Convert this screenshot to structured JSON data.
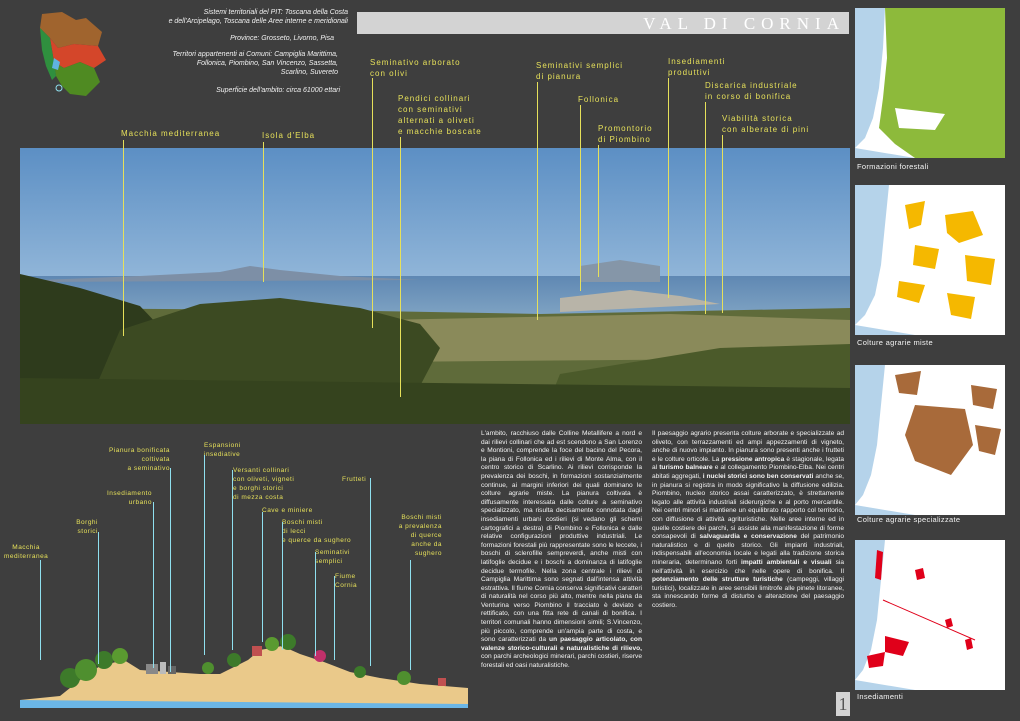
{
  "header": {
    "line1": "Sistemi territoriali del PIT: Toscana della Costa",
    "line2": "e dell'Arcipelago, Toscana delle Aree interne e meridionali",
    "title": "VAL DI CORNIA",
    "provinces": "Province: Grosseto, Livorno, Pisa",
    "municipalities_1": "Territori appartenenti ai Comuni: Campiglia Marittima,",
    "municipalities_2": "Follonica, Piombino, San Vincenzo, Sassetta,",
    "municipalities_3": "Scarlino, Suvereto",
    "area": "Superficie dell'ambito: circa 61000 ettari"
  },
  "panorama_labels": {
    "macchia": "Macchia mediterranea",
    "isola": "Isola d'Elba",
    "seminativo_arborato_1": "Seminativo arborato",
    "seminativo_arborato_2": "con olivi",
    "pendici_1": "Pendici collinari",
    "pendici_2": "con seminativi",
    "pendici_3": "alternati a oliveti",
    "pendici_4": "e macchie boscate",
    "seminativi_semplici_1": "Seminativi semplici",
    "seminativi_semplici_2": "di pianura",
    "follonica": "Follonica",
    "promontorio_1": "Promontorio",
    "promontorio_2": "di Piombino",
    "insediamenti_1": "Insediamenti",
    "insediamenti_2": "produttivi",
    "discarica_1": "Discarica industriale",
    "discarica_2": "in corso di bonifica",
    "viabilita_1": "Viabilità storica",
    "viabilita_2": "con alberate di pini"
  },
  "section_labels": {
    "espansioni_1": "Espansioni",
    "espansioni_2": "insediative",
    "pianura_1": "Pianura bonificata",
    "pianura_2": "coltivata",
    "pianura_3": "a seminativo",
    "versanti_1": "Versanti collinari",
    "versanti_2": "con oliveti, vigneti",
    "versanti_3": "e borghi storici",
    "versanti_4": "di mezza costa",
    "frutteti": "Frutteti",
    "insediamento_1": "Insediamento",
    "insediamento_2": "urbano",
    "cave": "Cave e miniere",
    "borghi_1": "Borghi",
    "borghi_2": "storici",
    "boschi_misti_1": "Boschi misti",
    "boschi_misti_2": "di lecci",
    "boschi_misti_3": "e querce da sughero",
    "boschi_prev_1": "Boschi misti",
    "boschi_prev_2": "a prevalenza",
    "boschi_prev_3": "di querce",
    "boschi_prev_4": "anche da",
    "boschi_prev_5": "sughero",
    "macchia_1": "Macchia",
    "macchia_2": "mediterranea",
    "seminativi_1": "Seminativi",
    "seminativi_2": "semplici",
    "fiume_1": "Fiume",
    "fiume_2": "Cornia"
  },
  "text_col1": "L'ambito, racchiuso dalle Colline Metallifere a nord e dai rilievi collinari che ad est scendono a San Lorenzo e Montioni, comprende la foce del bacino del Pecora, la piana di Follonica ed i rilievi di Monte Alma, con il centro storico di Scarlino. Ai rilievi corrisponde la prevalenza dei boschi, in formazioni sostanzialmente continue, ai margini inferiori dei quali dominano le colture agrarie miste. La pianura coltivata è diffusamente interessata dalle colture a seminativo specializzato, ma risulta decisamente connotata dagli insediamenti urbani costieri (si vedano gli schemi cartografici a destra) di Piombino e Follonica e dalle relative configurazioni produttive industriali. Le formazioni forestali più rappresentate sono le leccete, i boschi di sclerofille sempreverdi, anche misti con latifoglie decidue e i boschi a dominanza di latifoglie decidue termofile. Nella zona centrale i rilievi di Campiglia Marittima sono segnati dall'intensa attività estrattiva. Il fiume Cornia conserva significativi caratteri di naturalità nel corso più alto, mentre nella piana da Venturina verso Piombino il tracciato è deviato e rettificato, con una fitta rete di canali di bonifica. I territori comunali hanno dimensioni simili; S.Vincenzo, più piccolo, comprende un'ampia parte di costa, e sono caratterizzati da",
  "text_col1_bold": "un paesaggio articolato, con valenze storico-culturali e naturalistiche di rilievo,",
  "text_col1_end": " con parchi archeologici minerari, parchi costieri, riserve forestali ed oasi naturalistiche.",
  "text_col2_a": "Il paesaggio agrario presenta colture arborate e specializzate ad oliveto, con terrazzamenti ed ampi appezzamenti di vigneto, anche di nuovo impianto. In pianura sono presenti anche i frutteti e le colture orticole. La ",
  "text_col2_b": "pressione antropica",
  "text_col2_c": " è stagionale, legata al ",
  "text_col2_d": "turismo balneare",
  "text_col2_e": " e al collegamento Piombino-Elba. Nei centri abitati aggregati, ",
  "text_col2_f": "i nuclei storici sono ben conservati",
  "text_col2_g": " anche se, in pianura si registra in modo significativo la diffusione edilizia. Piombino, nucleo storico assai caratterizzato, è strettamente legato alle attività industriali siderurgiche e al porto mercantile. Nei centri minori si mantiene un equilibrato rapporto col territorio, con diffusione di attività agrituristiche. Nelle aree interne ed in quelle costiere dei parchi, si assiste alla manifestazione di forme consapevoli di ",
  "text_col2_h": "salvaguardia e conservazione",
  "text_col2_i": " del patrimonio naturalistico e di quello storico. Gli impianti industriali, indispensabili all'economia locale e legati alla tradizione storica mineraria, determinano forti ",
  "text_col2_j": "impatti ambientali e visuali",
  "text_col2_k": " sia nell'attività in esercizio che nelle opere di bonifica. Il ",
  "text_col2_l": "potenziamento delle strutture turistiche",
  "text_col2_m": " (campeggi, villaggi turistici), localizzate in aree sensibili limitrofe alle pinete litoranee, sta innescando forme di disturbo e alterazione del paesaggio costiero.",
  "maps": [
    {
      "caption": "Formazioni forestali",
      "color": "#8dba3b"
    },
    {
      "caption": "Colture agrarie miste",
      "color": "#f5b800"
    },
    {
      "caption": "Colture agrarie specializzate",
      "color": "#a86a3a"
    },
    {
      "caption": "Insediamenti",
      "color": "#e0001a"
    }
  ],
  "page_number": "1"
}
